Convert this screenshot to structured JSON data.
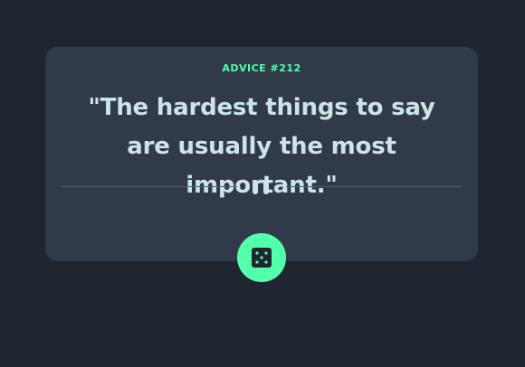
{
  "card": {
    "label": "ADVICE #212",
    "quote": "\"The hardest things to say are usually the most important.\""
  },
  "icons": {
    "divider": "pause-icon",
    "button": "dice-icon"
  },
  "colors": {
    "background": "#1f2632",
    "card": "#313a48",
    "accent": "#53ffab",
    "text": "#cee3e9",
    "divider": "#4f5d73"
  }
}
